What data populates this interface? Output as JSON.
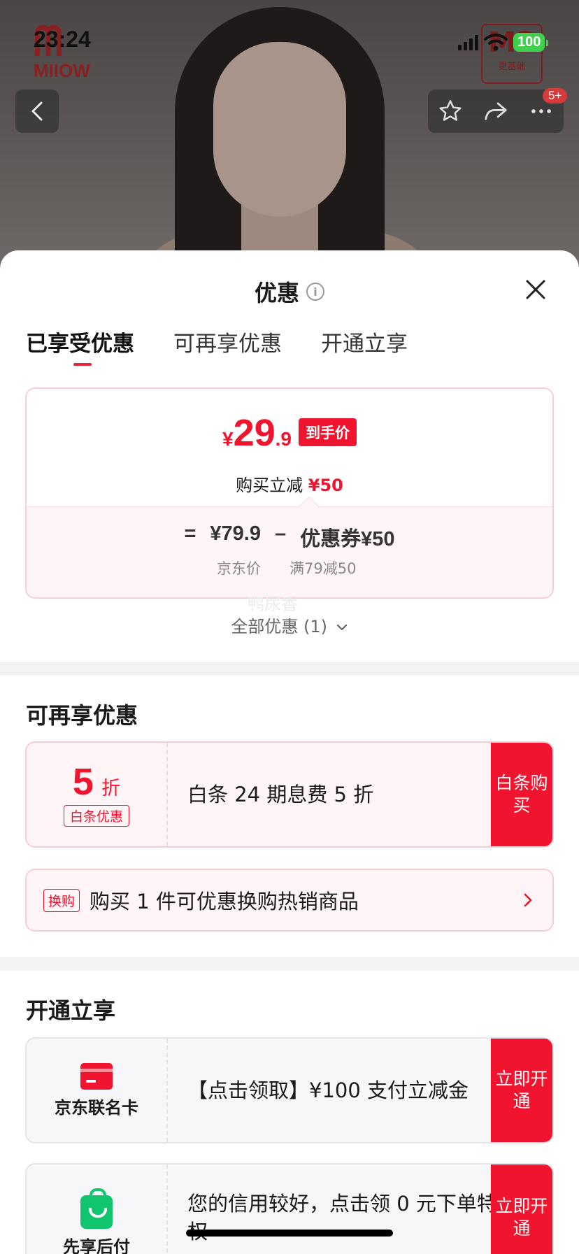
{
  "status_bar": {
    "time": "23:24",
    "battery": "100"
  },
  "product_image": {
    "brand_logo_text": "MIIOW",
    "corner_badge_big": "M3",
    "corner_badge_small": "更基础",
    "message_badge": "5+"
  },
  "sheet": {
    "title": "优惠",
    "tabs": [
      {
        "label": "已享受优惠",
        "active": true
      },
      {
        "label": "可再享优惠",
        "active": false
      },
      {
        "label": "开通立享",
        "active": false
      }
    ],
    "final_price": {
      "currency": "¥",
      "integer": "29",
      "decimal": ".9",
      "tag": "到手价",
      "reduce_text": "购买立减",
      "reduce_amount": "¥50"
    },
    "formula": {
      "equals": "=",
      "jd_price": "¥79.9",
      "minus": "–",
      "coupon": "优惠券¥50",
      "jd_price_label": "京东价",
      "coupon_label": "满79减50"
    },
    "watermark": "鸭尿香",
    "all_offers_label": "全部优惠 (1)"
  },
  "more_offers": {
    "title": "可再享优惠",
    "baitiao": {
      "discount_number": "5",
      "discount_unit": "折",
      "tag": "白条优惠",
      "text": "白条 24 期息费 5 折",
      "button": "白条购买"
    },
    "exchange": {
      "tag": "换购",
      "text": "购买 1 件可优惠换购热销商品"
    }
  },
  "open_offers": {
    "title": "开通立享",
    "items": [
      {
        "icon": "credit-card-icon",
        "left_label": "京东联名卡",
        "text": "【点击领取】¥100 支付立减金",
        "button": "立即开通"
      },
      {
        "icon": "shopping-bag-icon",
        "left_label": "先享后付",
        "text": "您的信用较好，点击领 0 元下单特权",
        "button": "立即开通"
      }
    ]
  },
  "colors": {
    "accent_red": "#f0142e",
    "pink_bg": "#fff5f7",
    "pink_border": "#f6cfd6",
    "green": "#11c46e"
  }
}
